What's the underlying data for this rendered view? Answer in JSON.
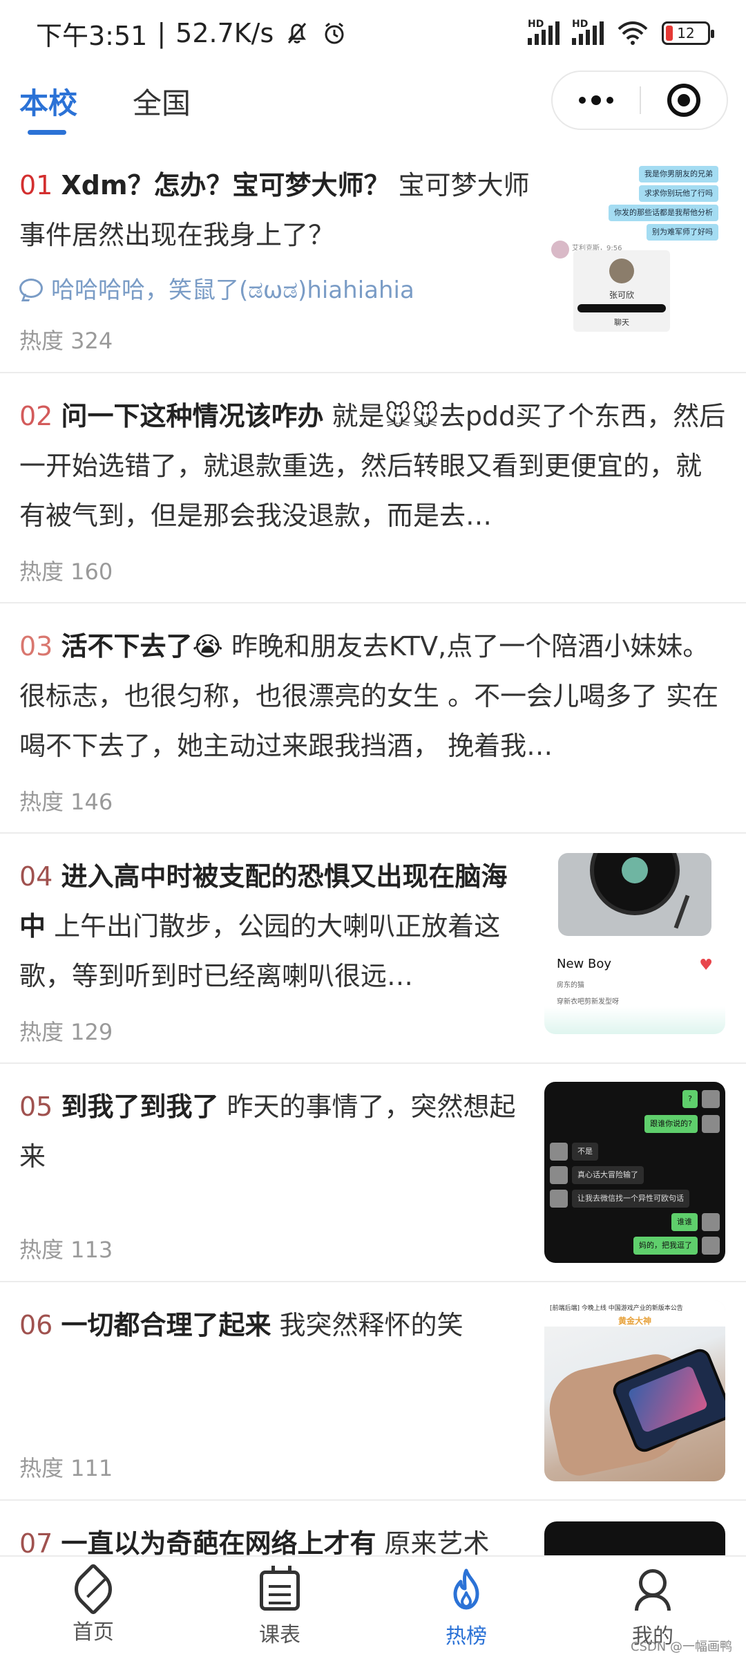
{
  "status_bar": {
    "time": "下午3:51",
    "separator": "|",
    "net_speed": "52.7K/s",
    "battery": "12",
    "hd1": "HD",
    "hd2": "HD"
  },
  "header": {
    "tabs": [
      {
        "label": "本校",
        "active": true
      },
      {
        "label": "全国",
        "active": false
      }
    ]
  },
  "posts": [
    {
      "rank": "01",
      "rank_color": "#d32f2f",
      "title": "Xdm？怎办？宝可梦大师？",
      "body": " 宝可梦大师事件居然出现在我身上了？",
      "comment": "哈哈哈哈，笑鼠了(ಡωಡ)hiahiahia",
      "heat": "热度 324",
      "thumb": {
        "bubbles": [
          "我是你男朋友的兄弟",
          "求求你别玩他了行吗",
          "你发的那些话都是我帮他分析",
          "别为难军师了好吗"
        ],
        "sender": "艾利克斯，9:56",
        "card_name": "张可欣",
        "card_button": "聊天"
      }
    },
    {
      "rank": "02",
      "rank_color": "#d35b5b",
      "title": "问一下这种情况该咋办",
      "body": " 就是🐭🐭去pdd买了个东西，然后一开始选错了，就退款重选，然后转眼又看到更便宜的，就有被气到，但是那会我没退款，而是去…",
      "heat": "热度 160"
    },
    {
      "rank": "03",
      "rank_color": "#d9776f",
      "title": "活不下去了😭",
      "body": " 昨晚和朋友去KTV,点了一个陪酒小妹妹。很标志，也很匀称，也很漂亮的女生 。不一会儿喝多了 实在喝不下去了，她主动过来跟我挡酒， 挽着我…",
      "heat": "热度 146"
    },
    {
      "rank": "04",
      "rank_color": "#a0524f",
      "title": "进入高中时被支配的恐惧又出现在脑海中",
      "body": " 上午出门散步，公园的大喇叭正放着这歌，等到听到时已经离喇叭很远…",
      "heat": "热度 129",
      "thumb": {
        "song": "New Boy",
        "meta": "房东的猫",
        "meta2": "穿新衣吧剪新发型呀"
      }
    },
    {
      "rank": "05",
      "rank_color": "#a0524f",
      "title": "到我了到我了",
      "body": " 昨天的事情了，突然想起来",
      "heat": "热度 113",
      "thumb": {
        "green1": "?",
        "green2": "跟谁你说的?",
        "dark1": "不是",
        "dark2": "真心话大冒险输了",
        "dark3": "让我去微信找一个异性可欧句话",
        "green3": "谁谁",
        "green4": "妈的，把我逗了"
      }
    },
    {
      "rank": "06",
      "rank_color": "#a0524f",
      "title": "一切都合理了起来",
      "body": " 我突然释怀的笑",
      "heat": "热度 111",
      "thumb": {
        "banner_top": "[前端后端] 今晚上线 中国游戏产业的新版本公告",
        "banner_title": "黄金大神"
      }
    },
    {
      "rank": "07",
      "rank_color": "#a0524f",
      "title": "一直以为奇葩在网络上才有",
      "body": " 原来艺术",
      "heat": ""
    }
  ],
  "tabbar": [
    {
      "label": "首页",
      "icon": "leaf-icon"
    },
    {
      "label": "课表",
      "icon": "calendar-icon"
    },
    {
      "label": "热榜",
      "icon": "fire-icon",
      "active": true
    },
    {
      "label": "我的",
      "icon": "user-icon"
    }
  ],
  "watermark": "CSDN @一幅画鸭",
  "colors": {
    "accent": "#2b72d6",
    "comment": "#7a9cc6",
    "heat": "#9a9a9a"
  }
}
